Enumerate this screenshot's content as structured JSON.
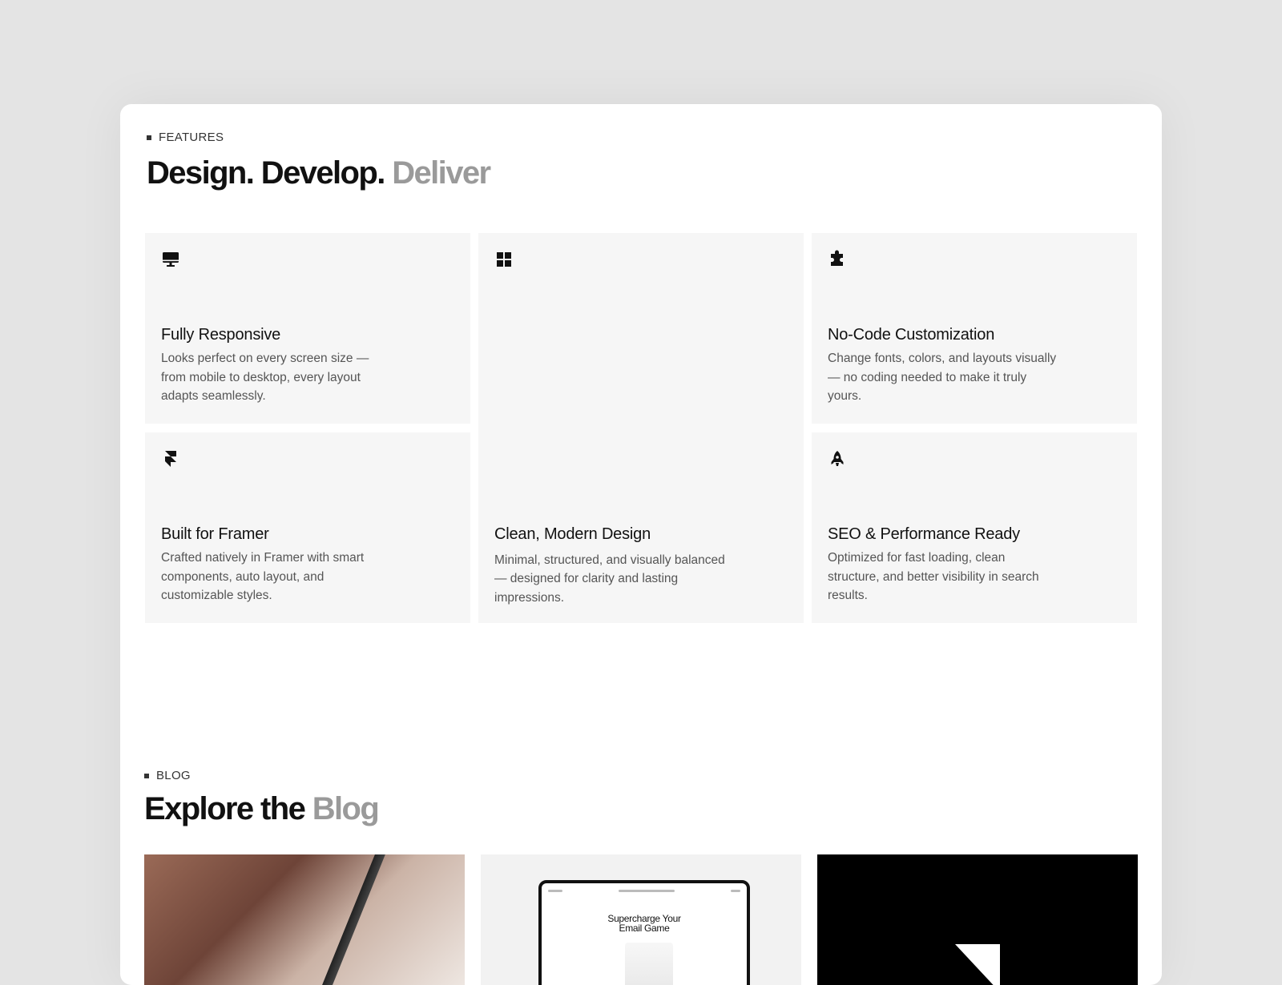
{
  "features": {
    "eyebrow": "FEATURES",
    "heading_main": "Design. Develop.",
    "heading_muted": "Deliver",
    "cards": [
      {
        "icon": "monitor-icon",
        "title": "Fully Responsive",
        "desc": "Looks perfect on every screen size — from mobile to desktop, every layout adapts seamlessly."
      },
      {
        "icon": "grid-icon",
        "title": "Clean, Modern Design",
        "desc": "Minimal, structured, and visually balanced — designed for clarity and lasting impressions."
      },
      {
        "icon": "puzzle-icon",
        "title": "No-Code Customization",
        "desc": "Change fonts, colors, and layouts visually — no coding needed to make it truly yours."
      },
      {
        "icon": "framer-icon",
        "title": "Built for Framer",
        "desc": "Crafted natively in Framer with smart components, auto layout, and customizable styles."
      },
      {
        "icon": "rocket-icon",
        "title": "SEO & Performance Ready",
        "desc": "Optimized for fast loading, clean structure, and better visibility in search results."
      }
    ]
  },
  "blog": {
    "eyebrow": "BLOG",
    "heading_main": "Explore the",
    "heading_muted": "Blog",
    "posts": [
      {
        "thumb_text": ""
      },
      {
        "thumb_text_line1": "Supercharge Your",
        "thumb_text_line2": "Email Game"
      },
      {
        "thumb_text": ""
      }
    ]
  },
  "colors": {
    "background": "#e4e4e4",
    "card": "#ffffff",
    "feature_card": "#f6f6f6",
    "muted_heading": "#9a9a9a"
  }
}
